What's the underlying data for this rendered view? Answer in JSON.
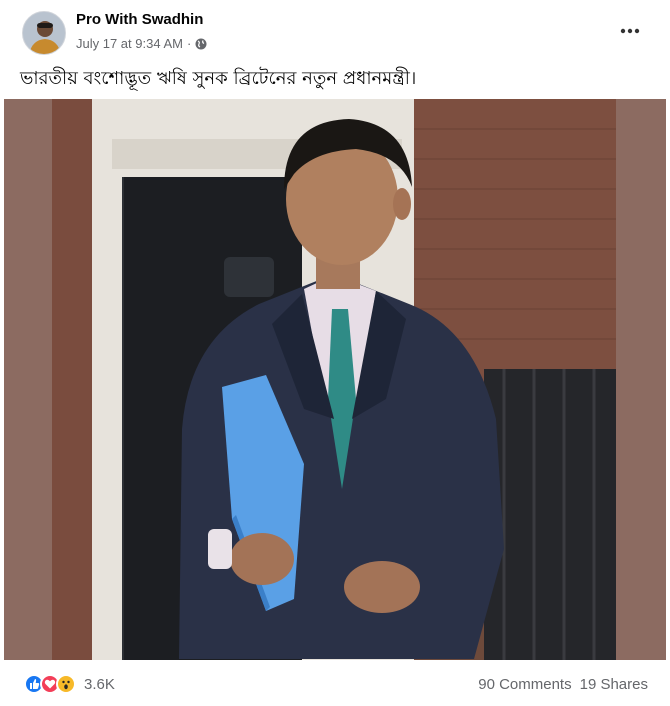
{
  "post": {
    "author": "Pro With Swadhin",
    "timestamp": "July 17 at 9:34 AM",
    "separator": "·",
    "privacy_icon": "globe-icon",
    "more_icon": "ellipsis-icon",
    "more_label": "•••",
    "caption": "ভারতীয় বংশোদ্ভূত ঋষি সুনক ব্রিটেনের নতুন প্রধানমন্ত্রী।"
  },
  "footer": {
    "reaction_icons": [
      "like-icon",
      "love-icon",
      "wow-icon"
    ],
    "reaction_count": "3.6K",
    "comments": "90 Comments",
    "shares": "19 Shares"
  },
  "colors": {
    "like": "#1877f2",
    "love": "#f33e58",
    "wow": "#f7b928",
    "secondary_text": "#65676b"
  }
}
